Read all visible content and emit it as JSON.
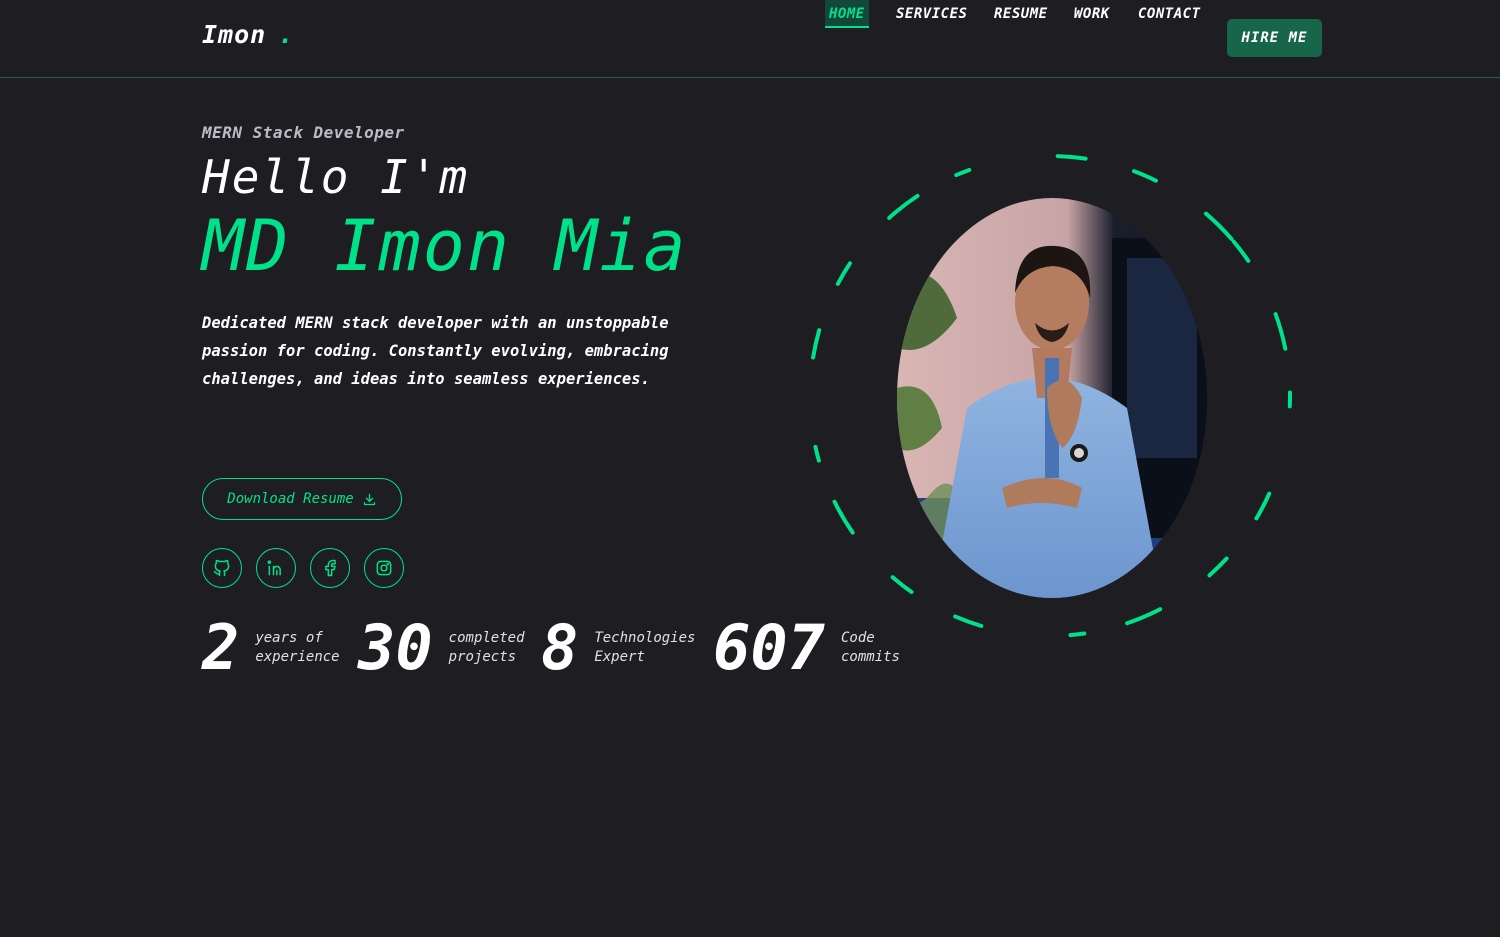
{
  "header": {
    "logo": "Imon",
    "logo_dot": ".",
    "nav": [
      {
        "label": "HOME",
        "active": true
      },
      {
        "label": "SERVICES",
        "active": false
      },
      {
        "label": "RESUME",
        "active": false
      },
      {
        "label": "WORK",
        "active": false
      },
      {
        "label": "CONTACT",
        "active": false
      }
    ],
    "hire_label": "HIRE ME"
  },
  "hero": {
    "role": "MERN Stack Developer",
    "greeting": "Hello I'm",
    "name": "MD Imon Mia",
    "description": "Dedicated MERN stack developer with an unstoppable passion for coding. Constantly evolving, embracing challenges, and ideas into seamless experiences.",
    "download_label": "Download Resume",
    "download_icon": "download-icon",
    "socials": [
      {
        "name": "github",
        "icon": "github-icon"
      },
      {
        "name": "linkedin",
        "icon": "linkedin-icon"
      },
      {
        "name": "facebook",
        "icon": "facebook-icon"
      },
      {
        "name": "instagram",
        "icon": "instagram-icon"
      }
    ]
  },
  "stats": [
    {
      "value": "2",
      "line1": "years of",
      "line2": "experience"
    },
    {
      "value": "30",
      "line1": "completed",
      "line2": "projects"
    },
    {
      "value": "8",
      "line1": "Technologies",
      "line2": "Expert"
    },
    {
      "value": "607",
      "line1": "Code",
      "line2": "commits"
    }
  ],
  "colors": {
    "background": "#1d1d22",
    "accent": "#00e28a",
    "accent_dark": "#17664a",
    "text": "#ffffff"
  }
}
